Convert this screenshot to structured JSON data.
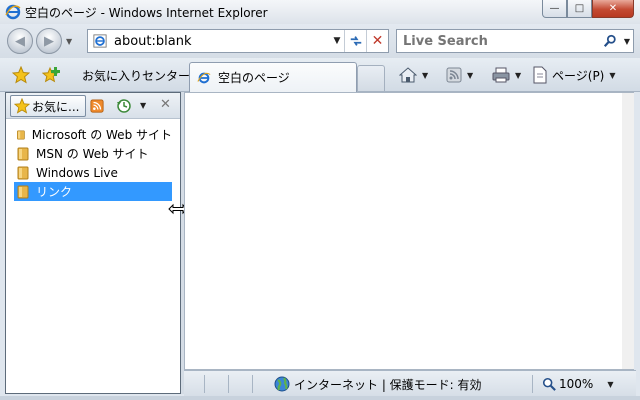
{
  "window": {
    "title": "空白のページ - Windows Internet Explorer"
  },
  "caption": {
    "minimize": "—",
    "maximize": "□",
    "close": "✕"
  },
  "address": {
    "url": "about:blank"
  },
  "search": {
    "placeholder": "Live Search"
  },
  "toolbar": {
    "favorites_center": "お気に入りセンター",
    "page_menu": "ページ(P)"
  },
  "tab": {
    "label": "空白のページ"
  },
  "favorites_pane": {
    "button_label": "お気に...",
    "items": [
      {
        "label": "Microsoft の Web サイト",
        "selected": false
      },
      {
        "label": "MSN の Web サイト",
        "selected": false
      },
      {
        "label": "Windows Live",
        "selected": false
      },
      {
        "label": "リンク",
        "selected": true
      }
    ]
  },
  "status": {
    "zone": "インターネット | 保護モード: 有効",
    "zoom": "100%"
  },
  "colors": {
    "selection": "#3399ff",
    "close_button": "#c44a33",
    "ie_blue": "#1f6fd1"
  }
}
